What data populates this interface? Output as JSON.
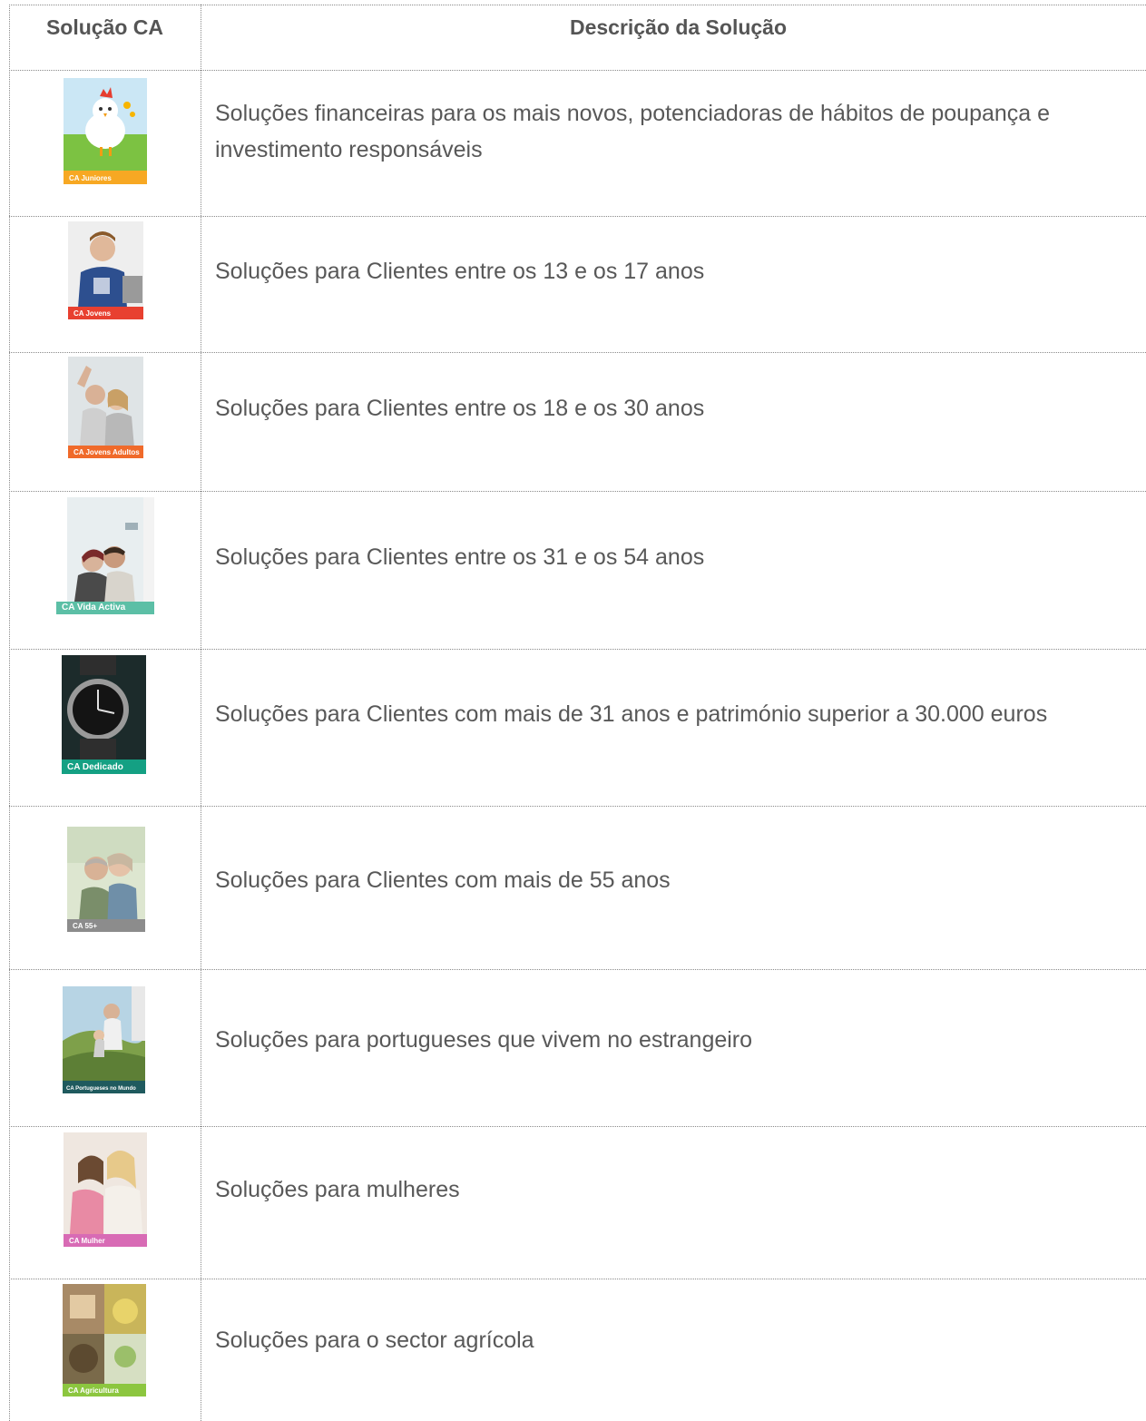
{
  "header": {
    "col1": "Solução CA",
    "col2": "Descrição da Solução"
  },
  "rows": [
    {
      "thumb_label": "CA Juniores",
      "band_color": "#f7a823",
      "description": "Soluções financeiras para os mais novos, potenciadoras de hábitos de poupança e investimento responsáveis"
    },
    {
      "thumb_label": "CA Jovens",
      "band_color": "#e84030",
      "description": "Soluções para Clientes entre os 13 e os 17 anos"
    },
    {
      "thumb_label": "CA Jovens Adultos",
      "band_color": "#f06a2a",
      "description": "Soluções para Clientes entre os 18 e os 30 anos"
    },
    {
      "thumb_label": "CA Vida Activa",
      "band_color": "#5cbfa6",
      "description": "Soluções para Clientes entre os 31 e os 54 anos"
    },
    {
      "thumb_label": "CA Dedicado",
      "band_color": "#14a083",
      "description": "Soluções para Clientes com mais de 31 anos e património superior a 30.000 euros"
    },
    {
      "thumb_label": "CA 55+",
      "band_color": "#8c8c8c",
      "description": "Soluções para Clientes com mais de 55 anos"
    },
    {
      "thumb_label": "CA Portugueses no Mundo",
      "band_color": "#1f5a5e",
      "description": "Soluções para portugueses que vivem no estrangeiro"
    },
    {
      "thumb_label": "CA Mulher",
      "band_color": "#d86bb5",
      "description": "Soluções para mulheres"
    },
    {
      "thumb_label": "CA Agricultura",
      "band_color": "#8cc63f",
      "description": "Soluções para o sector agrícola"
    }
  ]
}
